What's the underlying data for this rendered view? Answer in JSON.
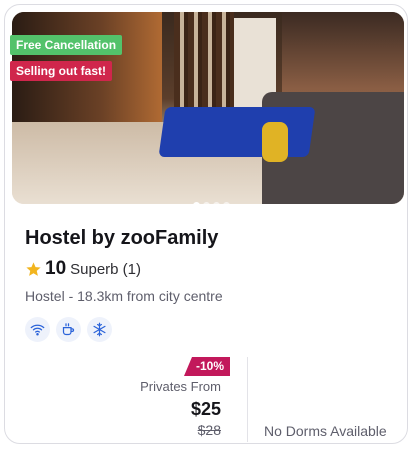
{
  "badges": {
    "free_cancellation": "Free Cancellation",
    "selling_out": "Selling out fast!"
  },
  "property": {
    "name": "Hostel by zooFamily",
    "rating_score": "10",
    "rating_text": "Superb (1)",
    "meta": "Hostel - 18.3km from city centre"
  },
  "facilities": [
    "wifi-icon",
    "coffee-icon",
    "snowflake-icon"
  ],
  "pricing": {
    "discount": "-10%",
    "privates_label": "Privates From",
    "price": "$25",
    "old_price": "$28",
    "dorms_label": "No Dorms Available"
  },
  "carousel": {
    "total_dots": 5,
    "active_index": 0
  },
  "colors": {
    "free_badge": "#53c26b",
    "selling_badge": "#d0264c",
    "discount": "#c2185b",
    "star": "#f2b51f",
    "facility_icon": "#2b63d9"
  }
}
